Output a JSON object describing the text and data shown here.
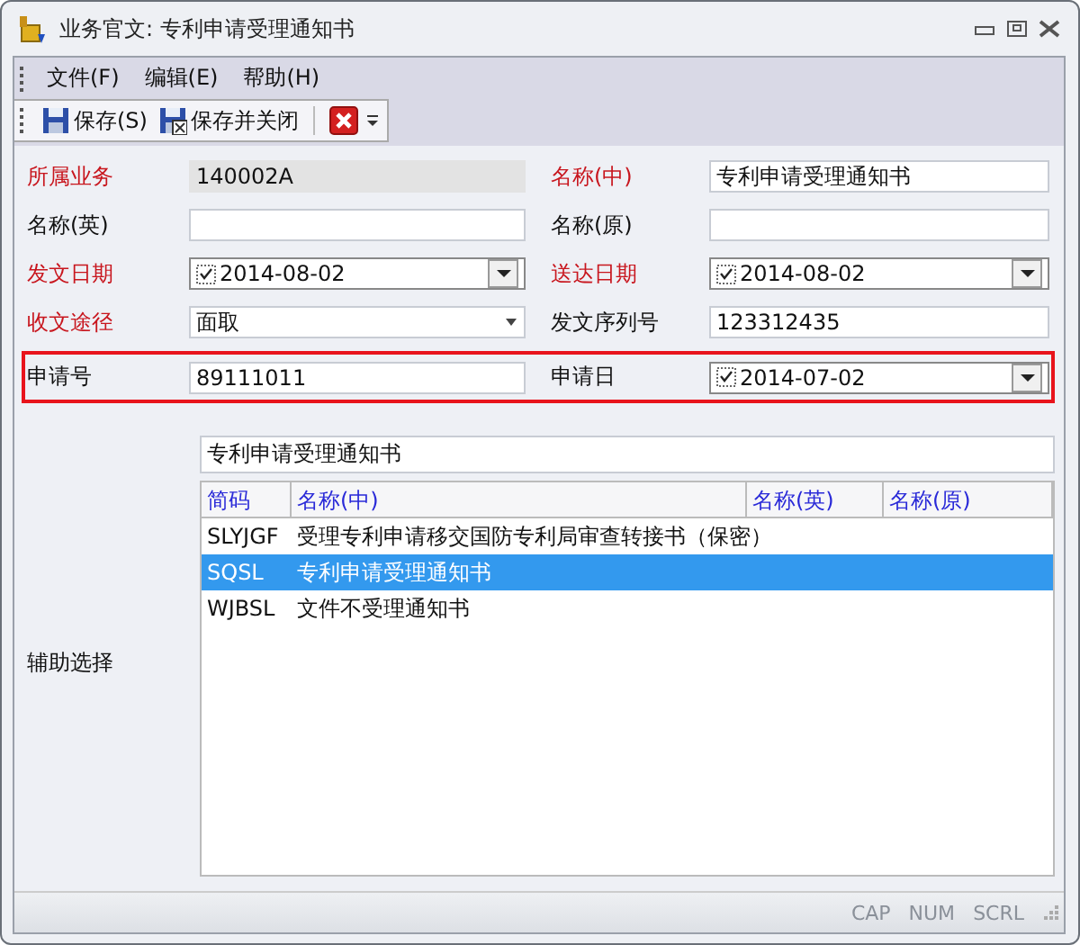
{
  "window": {
    "title": "业务官文: 专利申请受理通知书"
  },
  "menu": [
    {
      "label": "文件(F)"
    },
    {
      "label": "编辑(E)"
    },
    {
      "label": "帮助(H)"
    }
  ],
  "toolbar": [
    {
      "kind": "save",
      "label": "保存(S)"
    },
    {
      "kind": "save-close",
      "label": "保存并关闭"
    },
    {
      "kind": "delete"
    }
  ],
  "form": {
    "rows": [
      {
        "highlighted": false,
        "fields": [
          {
            "label": "所属业务",
            "required": true,
            "kind": "readonly",
            "value": "140002A"
          },
          {
            "label": "名称(中)",
            "required": true,
            "kind": "text",
            "value": "专利申请受理通知书"
          }
        ]
      },
      {
        "highlighted": false,
        "fields": [
          {
            "label": "名称(英)",
            "required": false,
            "kind": "text"
          },
          {
            "label": "名称(原)",
            "required": false,
            "kind": "text"
          }
        ]
      },
      {
        "highlighted": false,
        "fields": [
          {
            "label": "发文日期",
            "required": true,
            "kind": "date",
            "checked": true,
            "value": "2014-08-02"
          },
          {
            "label": "送达日期",
            "required": true,
            "kind": "date",
            "checked": true,
            "value": "2014-08-02"
          }
        ]
      },
      {
        "highlighted": false,
        "fields": [
          {
            "label": "收文途径",
            "required": true,
            "kind": "combo",
            "value": "面取"
          },
          {
            "label": "发文序列号",
            "required": false,
            "kind": "text",
            "value": "123312435"
          }
        ]
      },
      {
        "highlighted": true,
        "fields": [
          {
            "label": "申请号",
            "required": false,
            "kind": "text",
            "value": "89111011"
          },
          {
            "label": "申请日",
            "required": false,
            "kind": "date",
            "checked": true,
            "value": "2014-07-02"
          }
        ]
      }
    ]
  },
  "aux": {
    "label": "辅助选择",
    "search": {
      "value": "专利申请受理通知书"
    },
    "table": {
      "columns": [
        "简码",
        "名称(中)",
        "名称(英)",
        "名称(原)"
      ],
      "rows": [
        {
          "selected": false,
          "cells": [
            "SLYJGF",
            "受理专利申请移交国防专利局审查转接书（保密）"
          ]
        },
        {
          "selected": true,
          "cells": [
            "SQSL",
            "专利申请受理通知书"
          ]
        },
        {
          "selected": false,
          "cells": [
            "WJBSL",
            "文件不受理通知书"
          ]
        }
      ]
    }
  },
  "status_bar": [
    {
      "label": "CAP",
      "on": false
    },
    {
      "label": "NUM",
      "on": false
    },
    {
      "label": "SCRL",
      "on": false
    }
  ]
}
